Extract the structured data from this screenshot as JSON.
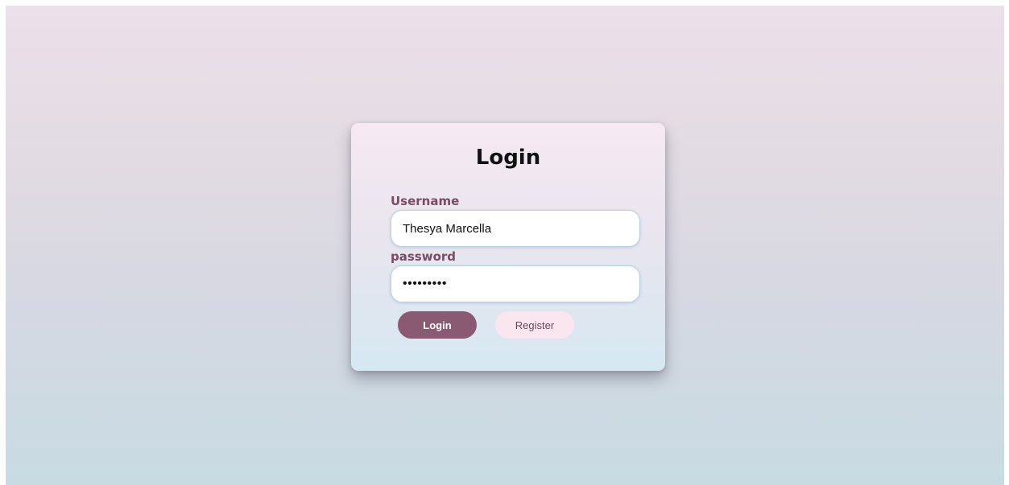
{
  "login_form": {
    "title": "Login",
    "username_label": "Username",
    "username_value": "Thesya Marcella",
    "password_label": "password",
    "password_value": "•••••••••",
    "login_button": "Login",
    "register_button": "Register"
  },
  "colors": {
    "accent": "#8a5a72",
    "label": "#7a4c64",
    "register_bg": "#fae6ef",
    "input_border": "#b6d2e6"
  }
}
